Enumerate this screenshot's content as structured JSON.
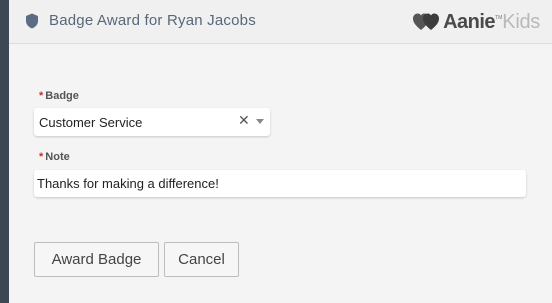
{
  "header": {
    "title": "Badge Award for Ryan Jacobs",
    "icon": "shield-icon"
  },
  "logo": {
    "part_a": "Aanie",
    "tm": "TM",
    "part_b": "Kids"
  },
  "form": {
    "badge": {
      "required_mark": "*",
      "label": "Badge",
      "value": "Customer Service",
      "clear_glyph": "✕"
    },
    "note": {
      "required_mark": "*",
      "label": "Note",
      "value": "Thanks for making a difference!"
    }
  },
  "buttons": {
    "award_label": "Award Badge",
    "cancel_label": "Cancel"
  },
  "colors": {
    "title_text": "#59677a",
    "required": "#c4302b",
    "rail": "#3e4754"
  }
}
